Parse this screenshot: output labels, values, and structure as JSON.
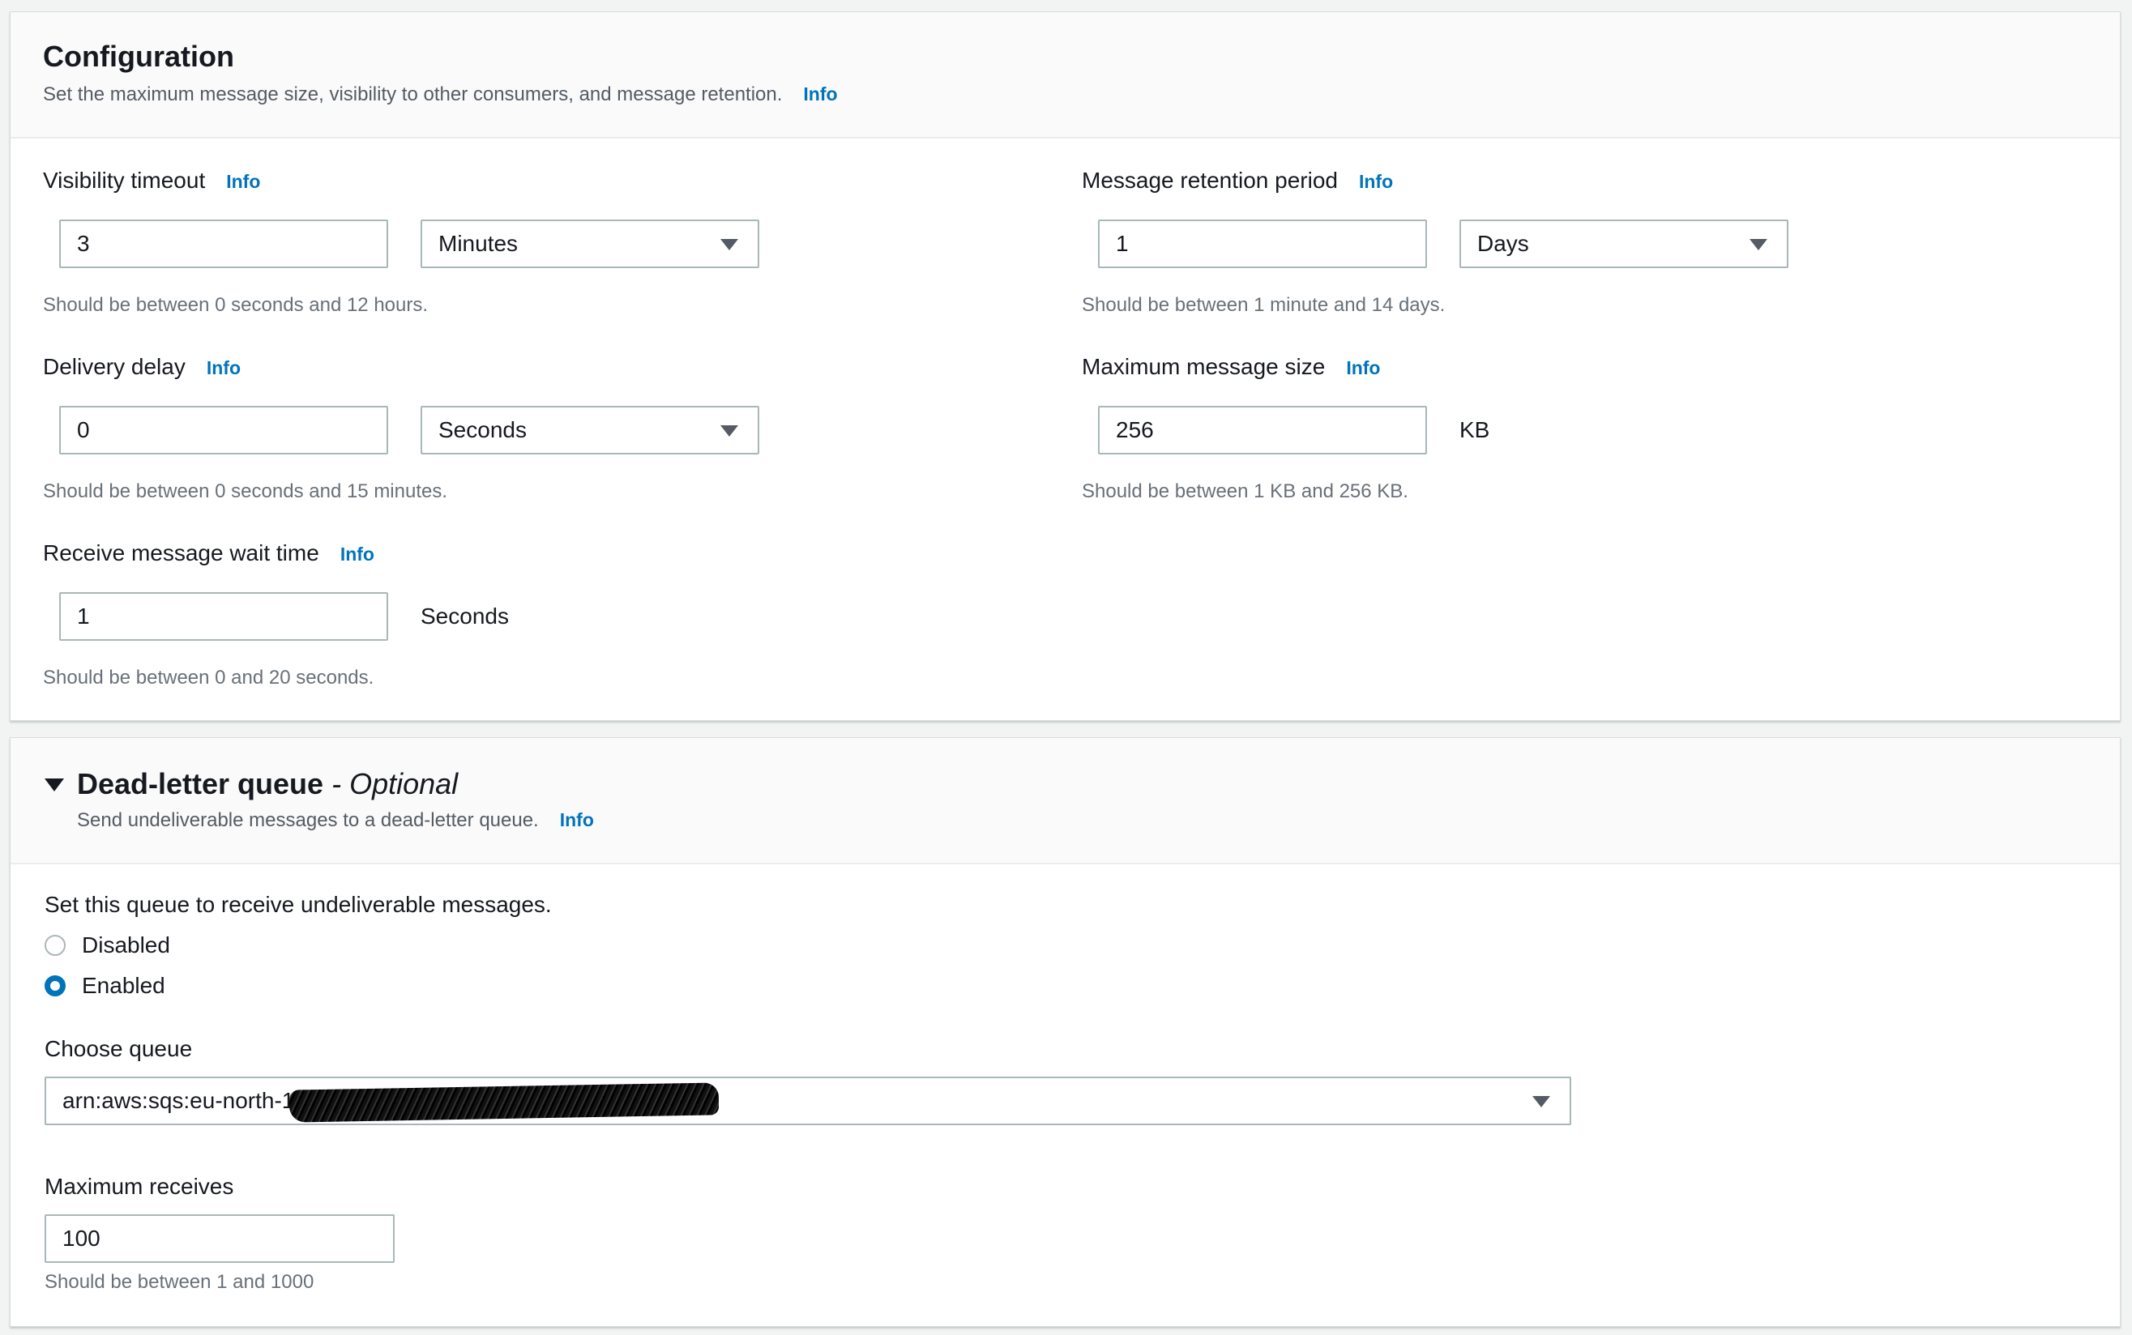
{
  "configuration": {
    "title": "Configuration",
    "description": "Set the maximum message size, visibility to other consumers, and message retention.",
    "info": "Info",
    "visibility_timeout": {
      "label": "Visibility timeout",
      "info": "Info",
      "value": "3",
      "unit": "Minutes",
      "hint": "Should be between 0 seconds and 12 hours."
    },
    "message_retention": {
      "label": "Message retention period",
      "info": "Info",
      "value": "1",
      "unit": "Days",
      "hint": "Should be between 1 minute and 14 days."
    },
    "delivery_delay": {
      "label": "Delivery delay",
      "info": "Info",
      "value": "0",
      "unit": "Seconds",
      "hint": "Should be between 0 seconds and 15 minutes."
    },
    "max_message_size": {
      "label": "Maximum message size",
      "info": "Info",
      "value": "256",
      "unit": "KB",
      "hint": "Should be between 1 KB and 256 KB."
    },
    "receive_wait_time": {
      "label": "Receive message wait time",
      "info": "Info",
      "value": "1",
      "unit": "Seconds",
      "hint": "Should be between 0 and 20 seconds."
    }
  },
  "dead_letter_queue": {
    "title": "Dead-letter queue",
    "separator": " - ",
    "optional": "Optional",
    "description": "Send undeliverable messages to a dead-letter queue.",
    "info": "Info",
    "question": "Set this queue to receive undeliverable messages.",
    "options": [
      {
        "label": "Disabled",
        "selected": false
      },
      {
        "label": "Enabled",
        "selected": true
      }
    ],
    "choose_queue": {
      "label": "Choose queue",
      "value_prefix": "arn:aws:sqs:eu-north-1"
    },
    "maximum_receives": {
      "label": "Maximum receives",
      "value": "100",
      "hint": "Should be between 1 and 1000"
    }
  },
  "colors": {
    "link": "#0073bb",
    "text": "#16191f",
    "hint": "#687078",
    "border": "#aab7b8"
  }
}
